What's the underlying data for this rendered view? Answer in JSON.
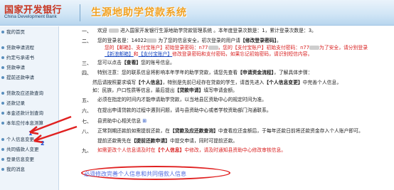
{
  "header": {
    "bank_name_cn": "国家开发银行",
    "bank_name_en": "China Development Bank",
    "system_title": "生源地助学贷款系统"
  },
  "sidebar": {
    "items": [
      {
        "label": "我的首页"
      },
      {
        "label": "贷款申请流程"
      },
      {
        "label": "约定与承诺书"
      },
      {
        "label": "贷款申请"
      },
      {
        "label": "提前还款申请"
      },
      {
        "label": "贷款及应还款查询"
      },
      {
        "label": "还款记录"
      },
      {
        "label": "本金还款计划查询"
      },
      {
        "label": "本年应付本息测算"
      },
      {
        "label": "个人信息变更"
      },
      {
        "label": "共同借款人变更"
      },
      {
        "label": "登录信息变更"
      },
      {
        "label": "我的消息"
      }
    ],
    "annotations": [
      "1",
      "2"
    ]
  },
  "notices": {
    "n1": {
      "num": "一、",
      "pre": "欢迎",
      "mid": "进入国家开发银行生源地助学贷款管理系统 。本年度登录次数是：1，累计登录次数是：3。"
    },
    "n2": {
      "num": "二、",
      "a": "您的登录名是：",
      "login_id": "14022",
      "b": "为了您的信息安全，初次登录的用户请",
      "c": "【修改登录密码】",
      "d": "。"
    },
    "n2_line2": {
      "a": "您的【邮箱】、支付宝账户】初始登录密码：",
      "b": "n77",
      "c": "，您的【支付宝账户】初始支付密码：",
      "d": "n77",
      "e": "为了安全，请分别登录"
    },
    "n2_line3": {
      "a": "【新浪邮箱】",
      "b": "和",
      "c": "【支付宝账户】",
      "d": "修改登录密码和支付密码，如果忘记初始密码，请识别短信内容。"
    },
    "n3": {
      "num": "三、",
      "a": "您可以点击",
      "b": "【查看】",
      "c": "您的账号信息。"
    },
    "n4": {
      "num": "四、",
      "a": "特别注意：您的联系信息将影响本年学年的助学贷款，请您先查看",
      "b": "【申请资金流程】",
      "c": "，了解具体步骤："
    },
    "n4_line2": {
      "a": "然后请按照要求填写",
      "b": "【个人信息】",
      "c": "，特别是先前已经存在贷款的学生，请首先进入",
      "d": "【个人信息变更】",
      "e": "中完善个人信息，"
    },
    "n4_line3": {
      "a": "如：民族，户口性质等信息，最后提出",
      "b": "【贷款申请】",
      "c": "填写申请金额。"
    },
    "n5": {
      "num": "五、",
      "a": "必须在指定的时间内才能申请助学贷款，以当地县区资助中心的规定时间为准。"
    },
    "n6": {
      "num": "六、",
      "a": "在提出申请贷款的过程中遇到问题，请与县资助中心或者学校资助部门沟通联系。"
    },
    "n7": {
      "num": "七、",
      "a": "县资助中心相关信息",
      "b": "⊞"
    },
    "n8": {
      "num": "八、",
      "a": "正常到期还款前如需提前还款，在",
      "b": "【贷款及应还款查询】",
      "c": "中查看应还金额后，于每年还款日前将还款资金存入个人账户即可。"
    },
    "n8_line2": {
      "a": "提前还款需先在",
      "b": "【提前还款申请】",
      "c": "中提交申请，同时可提前还款。"
    },
    "n9": {
      "num": "九、",
      "a": "如需更改个人信息请及时在",
      "b": "【个人信息】",
      "c": "中修改，",
      "d": "请及时通知县资助中心修改审核信息。"
    }
  },
  "bottom_link": "必须修改完善个人信息和共同借款人信息",
  "colors": {
    "accent_red": "#d81f1f",
    "accent_blue": "#1847c0",
    "title_orange": "#f0a020",
    "annotation_red": "#e02020"
  }
}
